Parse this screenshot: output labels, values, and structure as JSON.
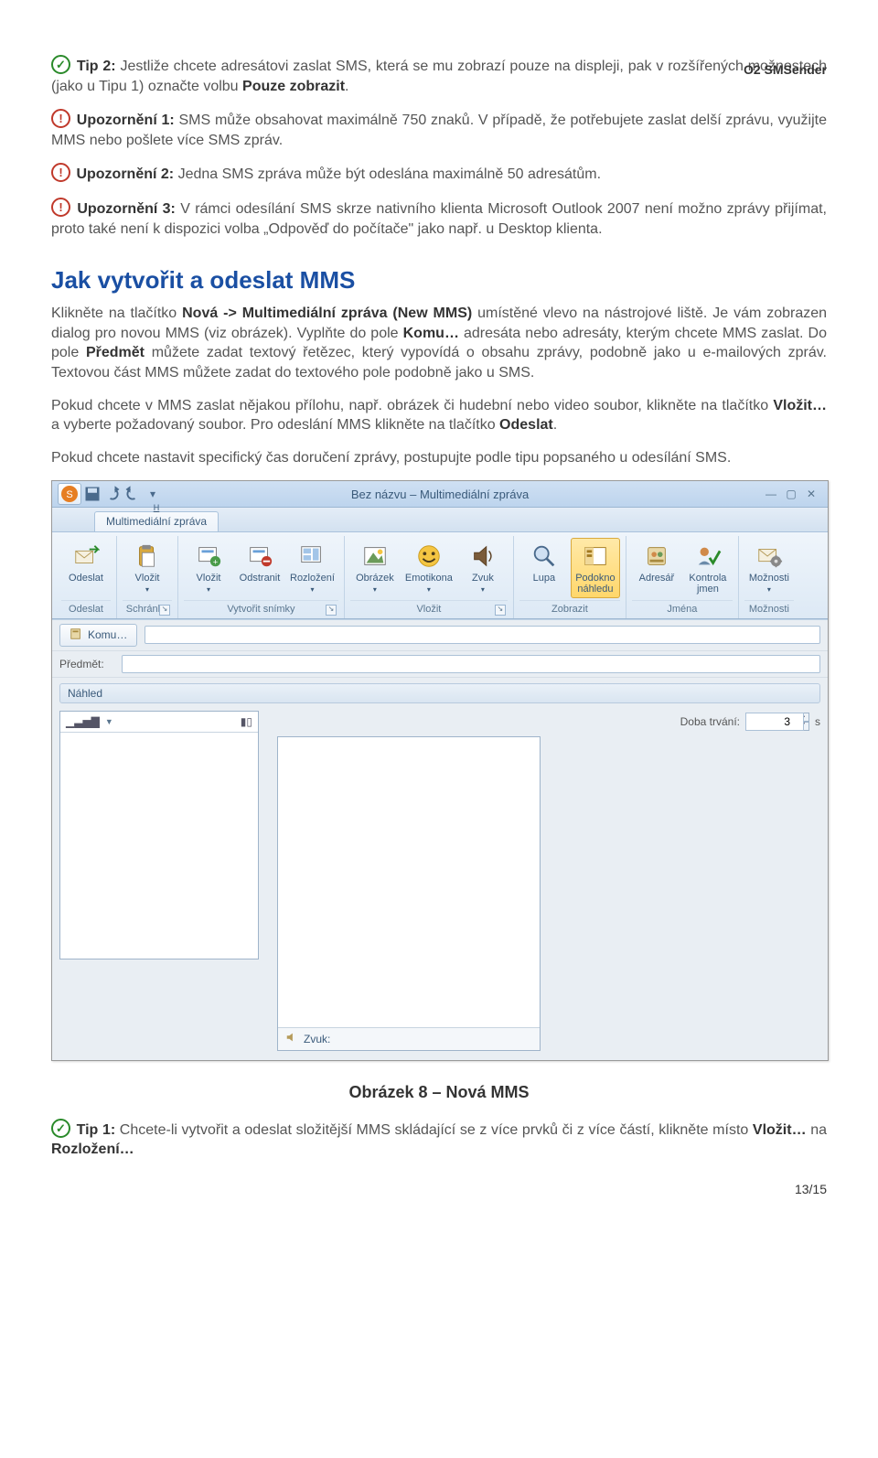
{
  "header": {
    "product": "O2 SMSender"
  },
  "tips": {
    "tip2_label": "Tip 2:",
    "tip2_text": " Jestliže chcete adresátovi zaslat SMS, která se mu zobrazí pouze na displeji, pak v rozšířených možnostech (jako u Tipu 1) označte volbu ",
    "tip2_bold": "Pouze zobrazit",
    "tip2_end": ".",
    "warn1_label": "Upozornění 1:",
    "warn1_text": " SMS může obsahovat maximálně 750 znaků. V případě, že potřebujete zaslat delší zprávu, využijte MMS nebo pošlete více SMS zpráv.",
    "warn2_label": "Upozornění 2:",
    "warn2_text": " Jedna SMS zpráva může být odeslána maximálně 50 adresátům.",
    "warn3_label": "Upozornění 3:",
    "warn3_text": " V rámci odesílání SMS skrze nativního klienta Microsoft Outlook 2007 není možno zprávy přijímat, proto také není k dispozici volba „Odpověď do počítače\" jako např. u Desktop klienta."
  },
  "section": {
    "title": "Jak vytvořit a odeslat MMS"
  },
  "paragraphs": {
    "p1a": "Klikněte na tlačítko ",
    "p1b": "Nová -> Multimediální zpráva (New MMS)",
    "p1c": " umístěné vlevo na nástrojové liště. Je vám zobrazen dialog pro novou MMS (viz obrázek). Vyplňte do pole ",
    "p1d": "Komu…",
    "p1e": " adresáta nebo adresáty, kterým chcete MMS zaslat. Do pole ",
    "p1f": "Předmět",
    "p1g": " můžete zadat textový řetězec, který vypovídá o obsahu zprávy, podobně jako u e-mailových zpráv. Textovou část MMS můžete zadat do textového pole podobně jako u SMS.",
    "p2a": "Pokud chcete v MMS zaslat nějakou přílohu, např. obrázek či hudební nebo video soubor, klikněte na tlačítko ",
    "p2b": "Vložit…",
    "p2c": " a vyberte požadovaný soubor. Pro odeslání MMS klikněte na tlačítko ",
    "p2d": "Odeslat",
    "p2e": ".",
    "p3": "Pokud chcete nastavit specifický čas doručení zprávy, postupujte podle tipu popsaného u odesílání SMS."
  },
  "screenshot": {
    "title": "Bez názvu – Multimediální zpráva",
    "tab": "Multimediální zpráva",
    "tab_key": "H",
    "ribbon": {
      "odeslat_btn": "Odeslat",
      "vlozit_clip": "Vložit",
      "group_odeslat": "Odeslat",
      "group_schranka": "Schránka",
      "vlozit": "Vložit",
      "odstranit": "Odstranit",
      "rozlozeni": "Rozložení",
      "group_snimky": "Vytvořit snímky",
      "obrazek": "Obrázek",
      "emotikona": "Emotikona",
      "zvuk": "Zvuk",
      "group_vlozit": "Vložit",
      "lupa": "Lupa",
      "podokno": "Podokno",
      "nahledu": "náhledu",
      "group_zobrazit": "Zobrazit",
      "adresar": "Adresář",
      "kontrola": "Kontrola",
      "jmen": "jmen",
      "group_jmena": "Jména",
      "moznosti": "Možnosti",
      "group_moznosti": "Možnosti"
    },
    "fields": {
      "komu": "Komu…",
      "predmet": "Předmět:",
      "nahled": "Náhled",
      "doba": "Doba trvání:",
      "doba_val": "3",
      "doba_unit": "s",
      "zvuk": "Zvuk:"
    }
  },
  "caption": "Obrázek 8 – Nová MMS",
  "tip_bottom": {
    "label": "Tip 1:",
    "text": " Chcete-li vytvořit a odeslat složitější MMS skládající se z více prvků či z více částí, klikněte místo ",
    "b1": "Vložit…",
    "mid": " na ",
    "b2": "Rozložení…"
  },
  "footer": {
    "page": "13/15"
  }
}
